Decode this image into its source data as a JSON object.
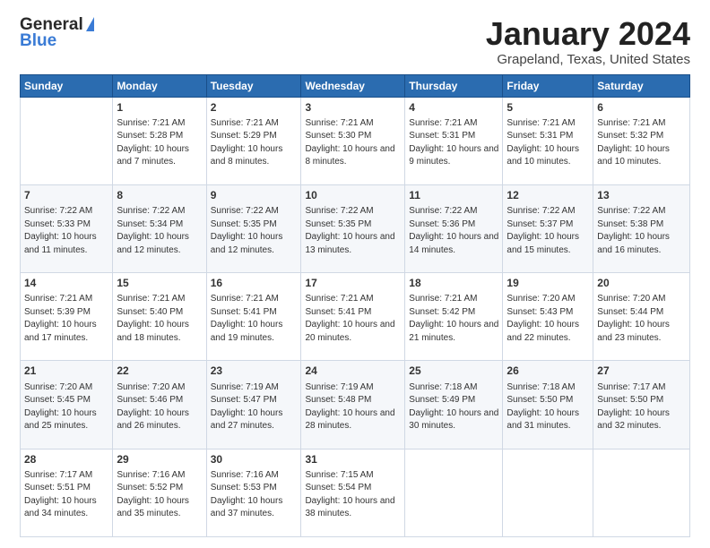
{
  "logo": {
    "general": "General",
    "blue": "Blue"
  },
  "title": "January 2024",
  "subtitle": "Grapeland, Texas, United States",
  "days_header": [
    "Sunday",
    "Monday",
    "Tuesday",
    "Wednesday",
    "Thursday",
    "Friday",
    "Saturday"
  ],
  "weeks": [
    [
      {
        "day": "",
        "sunrise": "",
        "sunset": "",
        "daylight": ""
      },
      {
        "day": "1",
        "sunrise": "Sunrise: 7:21 AM",
        "sunset": "Sunset: 5:28 PM",
        "daylight": "Daylight: 10 hours and 7 minutes."
      },
      {
        "day": "2",
        "sunrise": "Sunrise: 7:21 AM",
        "sunset": "Sunset: 5:29 PM",
        "daylight": "Daylight: 10 hours and 8 minutes."
      },
      {
        "day": "3",
        "sunrise": "Sunrise: 7:21 AM",
        "sunset": "Sunset: 5:30 PM",
        "daylight": "Daylight: 10 hours and 8 minutes."
      },
      {
        "day": "4",
        "sunrise": "Sunrise: 7:21 AM",
        "sunset": "Sunset: 5:31 PM",
        "daylight": "Daylight: 10 hours and 9 minutes."
      },
      {
        "day": "5",
        "sunrise": "Sunrise: 7:21 AM",
        "sunset": "Sunset: 5:31 PM",
        "daylight": "Daylight: 10 hours and 10 minutes."
      },
      {
        "day": "6",
        "sunrise": "Sunrise: 7:21 AM",
        "sunset": "Sunset: 5:32 PM",
        "daylight": "Daylight: 10 hours and 10 minutes."
      }
    ],
    [
      {
        "day": "7",
        "sunrise": "Sunrise: 7:22 AM",
        "sunset": "Sunset: 5:33 PM",
        "daylight": "Daylight: 10 hours and 11 minutes."
      },
      {
        "day": "8",
        "sunrise": "Sunrise: 7:22 AM",
        "sunset": "Sunset: 5:34 PM",
        "daylight": "Daylight: 10 hours and 12 minutes."
      },
      {
        "day": "9",
        "sunrise": "Sunrise: 7:22 AM",
        "sunset": "Sunset: 5:35 PM",
        "daylight": "Daylight: 10 hours and 12 minutes."
      },
      {
        "day": "10",
        "sunrise": "Sunrise: 7:22 AM",
        "sunset": "Sunset: 5:35 PM",
        "daylight": "Daylight: 10 hours and 13 minutes."
      },
      {
        "day": "11",
        "sunrise": "Sunrise: 7:22 AM",
        "sunset": "Sunset: 5:36 PM",
        "daylight": "Daylight: 10 hours and 14 minutes."
      },
      {
        "day": "12",
        "sunrise": "Sunrise: 7:22 AM",
        "sunset": "Sunset: 5:37 PM",
        "daylight": "Daylight: 10 hours and 15 minutes."
      },
      {
        "day": "13",
        "sunrise": "Sunrise: 7:22 AM",
        "sunset": "Sunset: 5:38 PM",
        "daylight": "Daylight: 10 hours and 16 minutes."
      }
    ],
    [
      {
        "day": "14",
        "sunrise": "Sunrise: 7:21 AM",
        "sunset": "Sunset: 5:39 PM",
        "daylight": "Daylight: 10 hours and 17 minutes."
      },
      {
        "day": "15",
        "sunrise": "Sunrise: 7:21 AM",
        "sunset": "Sunset: 5:40 PM",
        "daylight": "Daylight: 10 hours and 18 minutes."
      },
      {
        "day": "16",
        "sunrise": "Sunrise: 7:21 AM",
        "sunset": "Sunset: 5:41 PM",
        "daylight": "Daylight: 10 hours and 19 minutes."
      },
      {
        "day": "17",
        "sunrise": "Sunrise: 7:21 AM",
        "sunset": "Sunset: 5:41 PM",
        "daylight": "Daylight: 10 hours and 20 minutes."
      },
      {
        "day": "18",
        "sunrise": "Sunrise: 7:21 AM",
        "sunset": "Sunset: 5:42 PM",
        "daylight": "Daylight: 10 hours and 21 minutes."
      },
      {
        "day": "19",
        "sunrise": "Sunrise: 7:20 AM",
        "sunset": "Sunset: 5:43 PM",
        "daylight": "Daylight: 10 hours and 22 minutes."
      },
      {
        "day": "20",
        "sunrise": "Sunrise: 7:20 AM",
        "sunset": "Sunset: 5:44 PM",
        "daylight": "Daylight: 10 hours and 23 minutes."
      }
    ],
    [
      {
        "day": "21",
        "sunrise": "Sunrise: 7:20 AM",
        "sunset": "Sunset: 5:45 PM",
        "daylight": "Daylight: 10 hours and 25 minutes."
      },
      {
        "day": "22",
        "sunrise": "Sunrise: 7:20 AM",
        "sunset": "Sunset: 5:46 PM",
        "daylight": "Daylight: 10 hours and 26 minutes."
      },
      {
        "day": "23",
        "sunrise": "Sunrise: 7:19 AM",
        "sunset": "Sunset: 5:47 PM",
        "daylight": "Daylight: 10 hours and 27 minutes."
      },
      {
        "day": "24",
        "sunrise": "Sunrise: 7:19 AM",
        "sunset": "Sunset: 5:48 PM",
        "daylight": "Daylight: 10 hours and 28 minutes."
      },
      {
        "day": "25",
        "sunrise": "Sunrise: 7:18 AM",
        "sunset": "Sunset: 5:49 PM",
        "daylight": "Daylight: 10 hours and 30 minutes."
      },
      {
        "day": "26",
        "sunrise": "Sunrise: 7:18 AM",
        "sunset": "Sunset: 5:50 PM",
        "daylight": "Daylight: 10 hours and 31 minutes."
      },
      {
        "day": "27",
        "sunrise": "Sunrise: 7:17 AM",
        "sunset": "Sunset: 5:50 PM",
        "daylight": "Daylight: 10 hours and 32 minutes."
      }
    ],
    [
      {
        "day": "28",
        "sunrise": "Sunrise: 7:17 AM",
        "sunset": "Sunset: 5:51 PM",
        "daylight": "Daylight: 10 hours and 34 minutes."
      },
      {
        "day": "29",
        "sunrise": "Sunrise: 7:16 AM",
        "sunset": "Sunset: 5:52 PM",
        "daylight": "Daylight: 10 hours and 35 minutes."
      },
      {
        "day": "30",
        "sunrise": "Sunrise: 7:16 AM",
        "sunset": "Sunset: 5:53 PM",
        "daylight": "Daylight: 10 hours and 37 minutes."
      },
      {
        "day": "31",
        "sunrise": "Sunrise: 7:15 AM",
        "sunset": "Sunset: 5:54 PM",
        "daylight": "Daylight: 10 hours and 38 minutes."
      },
      {
        "day": "",
        "sunrise": "",
        "sunset": "",
        "daylight": ""
      },
      {
        "day": "",
        "sunrise": "",
        "sunset": "",
        "daylight": ""
      },
      {
        "day": "",
        "sunrise": "",
        "sunset": "",
        "daylight": ""
      }
    ]
  ]
}
